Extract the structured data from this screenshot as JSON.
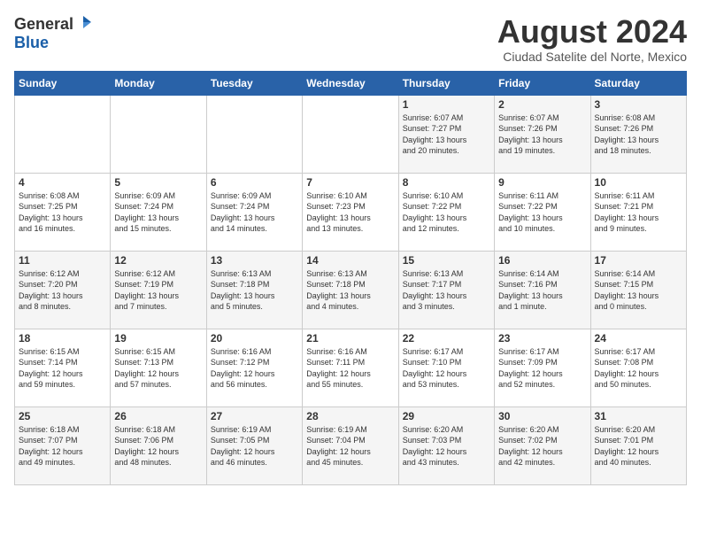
{
  "header": {
    "logo_general": "General",
    "logo_blue": "Blue",
    "month_title": "August 2024",
    "subtitle": "Ciudad Satelite del Norte, Mexico"
  },
  "calendar": {
    "days_of_week": [
      "Sunday",
      "Monday",
      "Tuesday",
      "Wednesday",
      "Thursday",
      "Friday",
      "Saturday"
    ],
    "weeks": [
      [
        {
          "day": "",
          "info": ""
        },
        {
          "day": "",
          "info": ""
        },
        {
          "day": "",
          "info": ""
        },
        {
          "day": "",
          "info": ""
        },
        {
          "day": "1",
          "info": "Sunrise: 6:07 AM\nSunset: 7:27 PM\nDaylight: 13 hours\nand 20 minutes."
        },
        {
          "day": "2",
          "info": "Sunrise: 6:07 AM\nSunset: 7:26 PM\nDaylight: 13 hours\nand 19 minutes."
        },
        {
          "day": "3",
          "info": "Sunrise: 6:08 AM\nSunset: 7:26 PM\nDaylight: 13 hours\nand 18 minutes."
        }
      ],
      [
        {
          "day": "4",
          "info": "Sunrise: 6:08 AM\nSunset: 7:25 PM\nDaylight: 13 hours\nand 16 minutes."
        },
        {
          "day": "5",
          "info": "Sunrise: 6:09 AM\nSunset: 7:24 PM\nDaylight: 13 hours\nand 15 minutes."
        },
        {
          "day": "6",
          "info": "Sunrise: 6:09 AM\nSunset: 7:24 PM\nDaylight: 13 hours\nand 14 minutes."
        },
        {
          "day": "7",
          "info": "Sunrise: 6:10 AM\nSunset: 7:23 PM\nDaylight: 13 hours\nand 13 minutes."
        },
        {
          "day": "8",
          "info": "Sunrise: 6:10 AM\nSunset: 7:22 PM\nDaylight: 13 hours\nand 12 minutes."
        },
        {
          "day": "9",
          "info": "Sunrise: 6:11 AM\nSunset: 7:22 PM\nDaylight: 13 hours\nand 10 minutes."
        },
        {
          "day": "10",
          "info": "Sunrise: 6:11 AM\nSunset: 7:21 PM\nDaylight: 13 hours\nand 9 minutes."
        }
      ],
      [
        {
          "day": "11",
          "info": "Sunrise: 6:12 AM\nSunset: 7:20 PM\nDaylight: 13 hours\nand 8 minutes."
        },
        {
          "day": "12",
          "info": "Sunrise: 6:12 AM\nSunset: 7:19 PM\nDaylight: 13 hours\nand 7 minutes."
        },
        {
          "day": "13",
          "info": "Sunrise: 6:13 AM\nSunset: 7:18 PM\nDaylight: 13 hours\nand 5 minutes."
        },
        {
          "day": "14",
          "info": "Sunrise: 6:13 AM\nSunset: 7:18 PM\nDaylight: 13 hours\nand 4 minutes."
        },
        {
          "day": "15",
          "info": "Sunrise: 6:13 AM\nSunset: 7:17 PM\nDaylight: 13 hours\nand 3 minutes."
        },
        {
          "day": "16",
          "info": "Sunrise: 6:14 AM\nSunset: 7:16 PM\nDaylight: 13 hours\nand 1 minute."
        },
        {
          "day": "17",
          "info": "Sunrise: 6:14 AM\nSunset: 7:15 PM\nDaylight: 13 hours\nand 0 minutes."
        }
      ],
      [
        {
          "day": "18",
          "info": "Sunrise: 6:15 AM\nSunset: 7:14 PM\nDaylight: 12 hours\nand 59 minutes."
        },
        {
          "day": "19",
          "info": "Sunrise: 6:15 AM\nSunset: 7:13 PM\nDaylight: 12 hours\nand 57 minutes."
        },
        {
          "day": "20",
          "info": "Sunrise: 6:16 AM\nSunset: 7:12 PM\nDaylight: 12 hours\nand 56 minutes."
        },
        {
          "day": "21",
          "info": "Sunrise: 6:16 AM\nSunset: 7:11 PM\nDaylight: 12 hours\nand 55 minutes."
        },
        {
          "day": "22",
          "info": "Sunrise: 6:17 AM\nSunset: 7:10 PM\nDaylight: 12 hours\nand 53 minutes."
        },
        {
          "day": "23",
          "info": "Sunrise: 6:17 AM\nSunset: 7:09 PM\nDaylight: 12 hours\nand 52 minutes."
        },
        {
          "day": "24",
          "info": "Sunrise: 6:17 AM\nSunset: 7:08 PM\nDaylight: 12 hours\nand 50 minutes."
        }
      ],
      [
        {
          "day": "25",
          "info": "Sunrise: 6:18 AM\nSunset: 7:07 PM\nDaylight: 12 hours\nand 49 minutes."
        },
        {
          "day": "26",
          "info": "Sunrise: 6:18 AM\nSunset: 7:06 PM\nDaylight: 12 hours\nand 48 minutes."
        },
        {
          "day": "27",
          "info": "Sunrise: 6:19 AM\nSunset: 7:05 PM\nDaylight: 12 hours\nand 46 minutes."
        },
        {
          "day": "28",
          "info": "Sunrise: 6:19 AM\nSunset: 7:04 PM\nDaylight: 12 hours\nand 45 minutes."
        },
        {
          "day": "29",
          "info": "Sunrise: 6:20 AM\nSunset: 7:03 PM\nDaylight: 12 hours\nand 43 minutes."
        },
        {
          "day": "30",
          "info": "Sunrise: 6:20 AM\nSunset: 7:02 PM\nDaylight: 12 hours\nand 42 minutes."
        },
        {
          "day": "31",
          "info": "Sunrise: 6:20 AM\nSunset: 7:01 PM\nDaylight: 12 hours\nand 40 minutes."
        }
      ]
    ]
  }
}
